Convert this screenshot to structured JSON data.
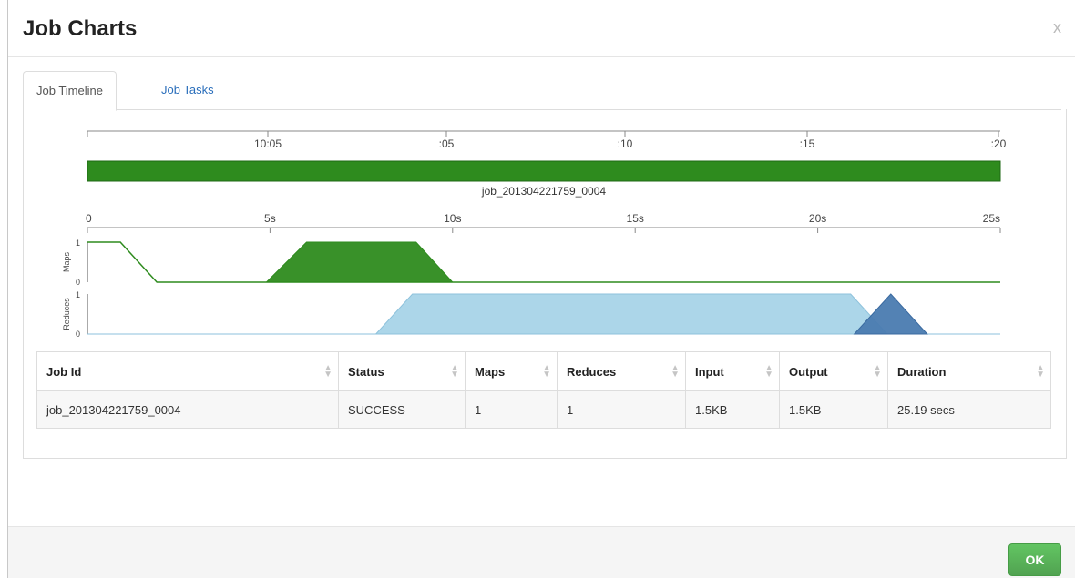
{
  "modal": {
    "title": "Job Charts",
    "close_label": "x"
  },
  "tabs": [
    {
      "label": "Job Timeline",
      "active": true
    },
    {
      "label": "Job Tasks",
      "active": false
    }
  ],
  "chart_data": [
    {
      "type": "area",
      "title": "",
      "x_axis_ticks": [
        "10:05",
        ":05",
        ":10",
        ":15",
        ":20"
      ],
      "bar_label": "job_201304221759_0004",
      "bar_color": "#2e8b1e"
    },
    {
      "type": "area",
      "x_ticks": [
        0,
        5,
        10,
        15,
        20,
        25
      ],
      "x_tick_labels": [
        "0",
        "5s",
        "10s",
        "15s",
        "20s",
        "25s"
      ],
      "xlim": [
        0,
        25
      ],
      "panels": [
        {
          "ylabel": "Maps",
          "ylim": [
            0,
            1
          ],
          "y_tick_labels": [
            "1",
            "0"
          ],
          "series": [
            {
              "fill": "none",
              "stroke": "#2e8b1e",
              "points": [
                [
                  0,
                  1
                ],
                [
                  0.9,
                  1
                ],
                [
                  1.9,
                  0
                ],
                [
                  25,
                  0
                ]
              ]
            },
            {
              "fill": "#2e8b1e",
              "stroke": "#2e8b1e",
              "points": [
                [
                  4.9,
                  0
                ],
                [
                  6,
                  1
                ],
                [
                  9,
                  1
                ],
                [
                  10,
                  0
                ]
              ]
            }
          ]
        },
        {
          "ylabel": "Reduces",
          "ylim": [
            0,
            1
          ],
          "y_tick_labels": [
            "1",
            "0"
          ],
          "series": [
            {
              "fill": "#a8d4e8",
              "stroke": "#8ec2dc",
              "points": [
                [
                  0,
                  0
                ],
                [
                  7.9,
                  0
                ],
                [
                  8.9,
                  1
                ],
                [
                  20.9,
                  1
                ],
                [
                  21.9,
                  0
                ],
                [
                  25,
                  0
                ]
              ]
            },
            {
              "fill": "#4a7bb0",
              "stroke": "#3a6aa0",
              "points": [
                [
                  21,
                  0
                ],
                [
                  22,
                  1
                ],
                [
                  23,
                  0
                ]
              ]
            }
          ]
        }
      ]
    }
  ],
  "table": {
    "headers": [
      "Job Id",
      "Status",
      "Maps",
      "Reduces",
      "Input",
      "Output",
      "Duration"
    ],
    "rows": [
      [
        "job_201304221759_0004",
        "SUCCESS",
        "1",
        "1",
        "1.5KB",
        "1.5KB",
        "25.19 secs"
      ]
    ]
  },
  "footer": {
    "ok_label": "OK"
  }
}
